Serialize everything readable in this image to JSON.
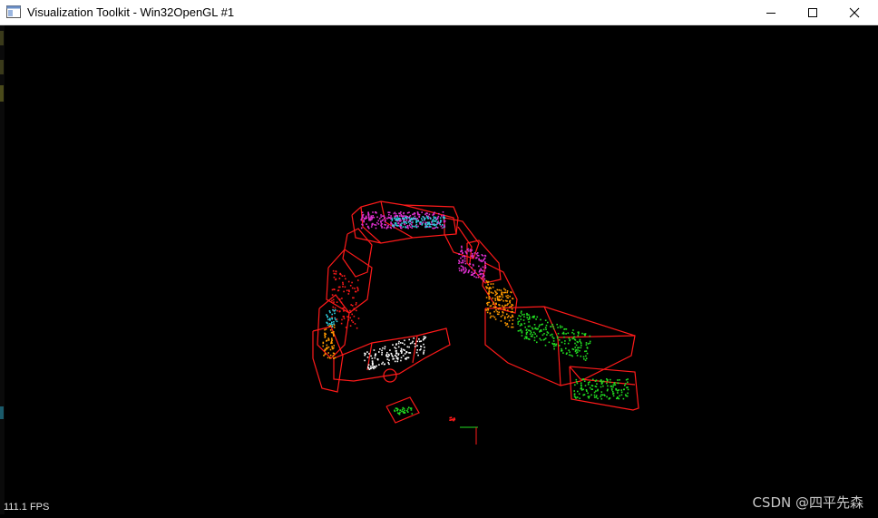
{
  "window": {
    "title": "Visualization Toolkit - Win32OpenGL #1",
    "icon": "vtk-window-icon"
  },
  "controls": {
    "minimize": "minimize-icon",
    "maximize": "maximize-icon",
    "close": "close-icon"
  },
  "render": {
    "fps_label": "111.1 FPS",
    "background": "#000000",
    "colors": {
      "boxes": "#ff1a1a",
      "cluster_green": "#22dd22",
      "cluster_magenta": "#e030d0",
      "cluster_orange": "#ff9900",
      "cluster_white": "#ffffff",
      "cluster_cyan": "#30d0e0"
    }
  },
  "watermark": "CSDN @四平先森"
}
